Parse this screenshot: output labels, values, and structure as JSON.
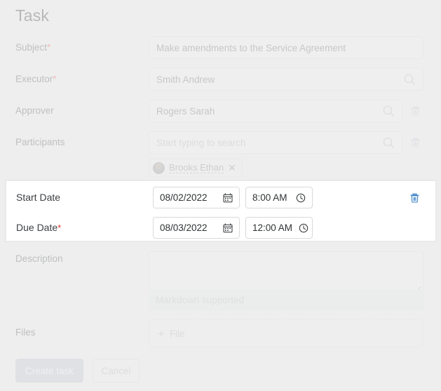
{
  "page": {
    "title": "Task"
  },
  "fields": {
    "subject": {
      "label": "Subject",
      "required": "*",
      "value": "Make amendments to the Service Agreement"
    },
    "executor": {
      "label": "Executor",
      "required": "*",
      "value": "Smith Andrew",
      "search_icon": "search-icon"
    },
    "approver": {
      "label": "Approver",
      "value": "Rogers Sarah",
      "search_icon": "search-icon",
      "delete_icon": "trash-icon"
    },
    "participants": {
      "label": "Participants",
      "placeholder": "Start typing to search",
      "search_icon": "search-icon",
      "delete_icon": "trash-icon",
      "chips": [
        {
          "name": "Brooks Ethan",
          "remove_icon": "close-icon"
        }
      ]
    },
    "description": {
      "label": "Description",
      "value": "",
      "hint": "Markdown supported"
    },
    "files": {
      "label": "Files",
      "add_label": "File",
      "add_icon": "plus-icon"
    }
  },
  "highlight": {
    "start_date": {
      "label": "Start Date",
      "required": "",
      "date": "08/02/2022",
      "date_icon": "calendar-icon",
      "time": "8:00 AM",
      "time_icon": "clock-icon"
    },
    "due_date": {
      "label": "Due Date",
      "required": "*",
      "date": "08/03/2022",
      "date_icon": "calendar-icon",
      "time": "12:00 AM",
      "time_icon": "clock-icon"
    },
    "delete_icon": "trash-icon",
    "accent_color": "#3f85c6"
  },
  "footer": {
    "submit_label": "Create task",
    "cancel_label": "Cancel"
  },
  "colors": {
    "background": "#eeeeee",
    "required_marker": "#e8342a",
    "primary_button": "#c3c9d3"
  }
}
